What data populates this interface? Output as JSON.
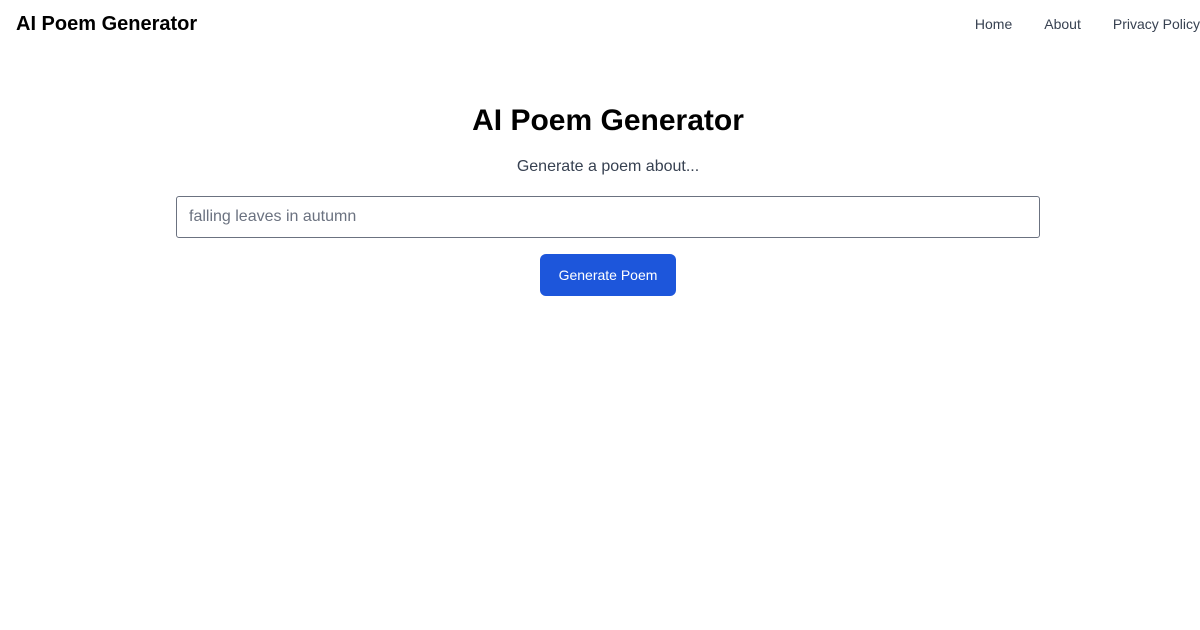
{
  "header": {
    "brand": "AI Poem Generator",
    "nav": [
      {
        "label": "Home"
      },
      {
        "label": "About"
      },
      {
        "label": "Privacy Policy"
      }
    ]
  },
  "main": {
    "title": "AI Poem Generator",
    "subtitle": "Generate a poem about...",
    "topic_input": {
      "value": "",
      "placeholder": "falling leaves in autumn"
    },
    "generate_button_label": "Generate Poem"
  },
  "colors": {
    "accent": "#1d56db",
    "text": "#000000",
    "muted_text": "#374151",
    "input_border": "#6b7280",
    "background": "#ffffff"
  }
}
